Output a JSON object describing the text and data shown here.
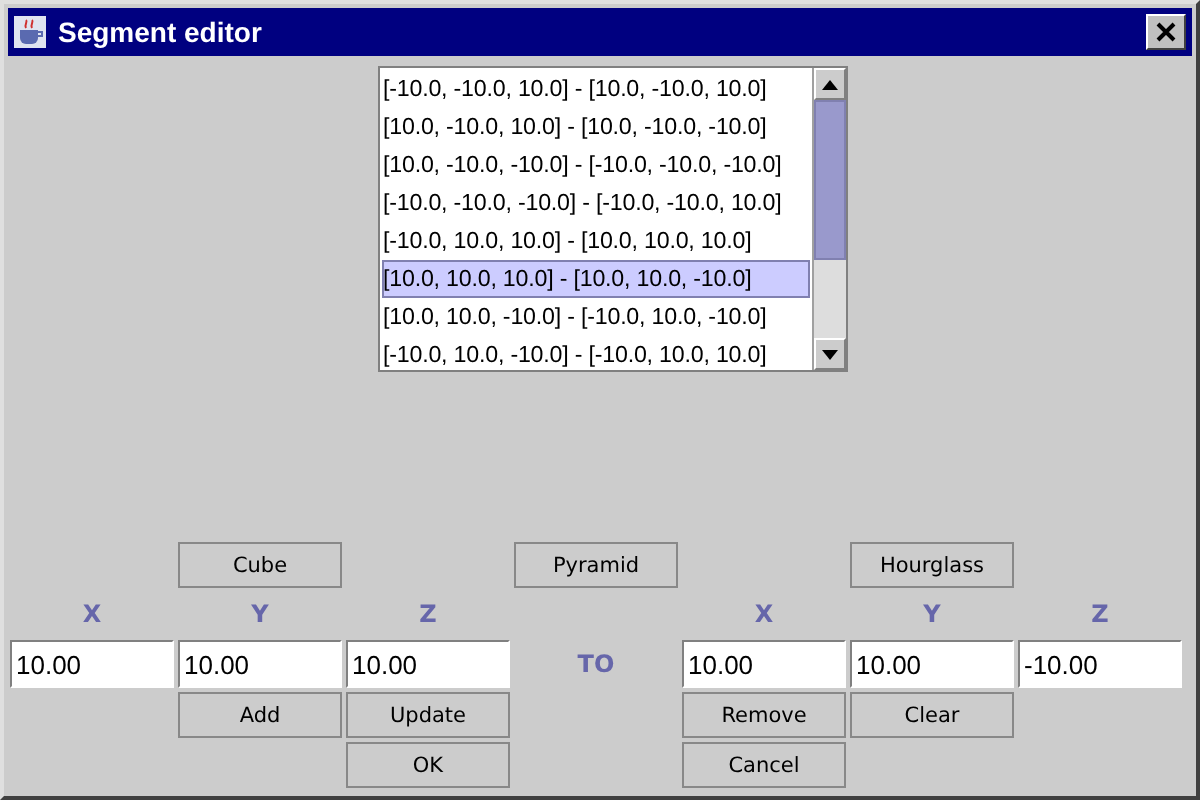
{
  "window": {
    "title": "Segment editor"
  },
  "segments": [
    {
      "label": "[-10.0, -10.0, 10.0] - [10.0, -10.0, 10.0]",
      "selected": false
    },
    {
      "label": "[10.0, -10.0, 10.0] - [10.0, -10.0, -10.0]",
      "selected": false
    },
    {
      "label": "[10.0, -10.0, -10.0] - [-10.0, -10.0, -10.0]",
      "selected": false
    },
    {
      "label": "[-10.0, -10.0, -10.0] - [-10.0, -10.0, 10.0]",
      "selected": false
    },
    {
      "label": "[-10.0, 10.0, 10.0] - [10.0, 10.0, 10.0]",
      "selected": false
    },
    {
      "label": "[10.0, 10.0, 10.0] - [10.0, 10.0, -10.0]",
      "selected": true
    },
    {
      "label": "[10.0, 10.0, -10.0] - [-10.0, 10.0, -10.0]",
      "selected": false
    },
    {
      "label": "[-10.0, 10.0, -10.0] - [-10.0, 10.0, 10.0]",
      "selected": false
    }
  ],
  "shape_buttons": [
    "Cube",
    "Pyramid",
    "Hourglass"
  ],
  "from": {
    "fields": [
      {
        "label": "X",
        "value": "10.00"
      },
      {
        "label": "Y",
        "value": "10.00"
      },
      {
        "label": "Z",
        "value": "10.00"
      }
    ]
  },
  "to_label": "TO",
  "to": {
    "fields": [
      {
        "label": "X",
        "value": "10.00"
      },
      {
        "label": "Y",
        "value": "10.00"
      },
      {
        "label": "Z",
        "value": "-10.00"
      }
    ]
  },
  "buttons": [
    {
      "label": "Add"
    },
    {
      "label": "Update"
    },
    {
      "label": "Remove"
    },
    {
      "label": "Clear"
    },
    {
      "label": "OK"
    },
    {
      "label": "Cancel"
    }
  ]
}
